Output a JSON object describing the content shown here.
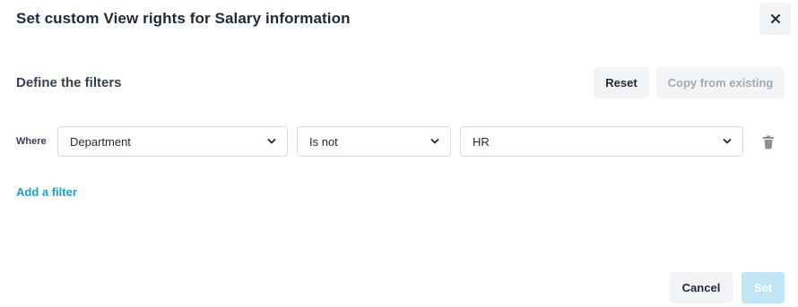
{
  "dialog": {
    "title": "Set custom View rights for Salary information"
  },
  "filters_section": {
    "title": "Define the filters",
    "reset_label": "Reset",
    "copy_label": "Copy from existing"
  },
  "filter_row": {
    "where_label": "Where",
    "field_value": "Department",
    "operator_value": "Is not",
    "value_value": "HR"
  },
  "add_filter_label": "Add a filter",
  "footer": {
    "cancel_label": "Cancel",
    "set_label": "Set"
  },
  "colors": {
    "accent": "#1aa1d4",
    "disabled_primary": "#bfe6f5",
    "secondary_button": "#f1f3f5"
  },
  "icons": {
    "close": "close-icon",
    "chevron": "chevron-down-icon",
    "trash": "trash-icon"
  }
}
